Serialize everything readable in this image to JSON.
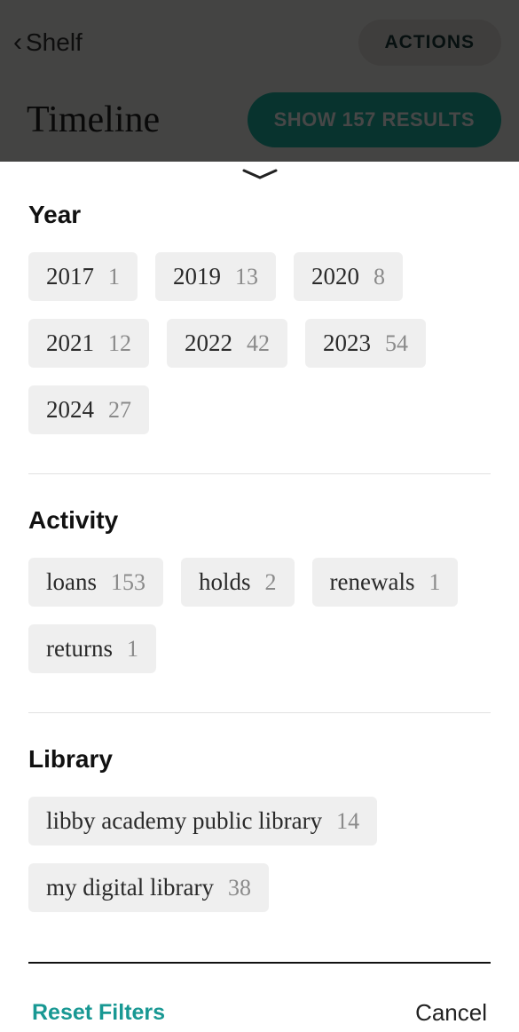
{
  "header": {
    "back_label": "Shelf",
    "actions_label": "ACTIONS",
    "title": "Timeline",
    "show_results_label": "SHOW 157 RESULTS"
  },
  "sections": {
    "year": {
      "title": "Year",
      "items": [
        {
          "label": "2017",
          "count": "1"
        },
        {
          "label": "2019",
          "count": "13"
        },
        {
          "label": "2020",
          "count": "8"
        },
        {
          "label": "2021",
          "count": "12"
        },
        {
          "label": "2022",
          "count": "42"
        },
        {
          "label": "2023",
          "count": "54"
        },
        {
          "label": "2024",
          "count": "27"
        }
      ]
    },
    "activity": {
      "title": "Activity",
      "items": [
        {
          "label": "loans",
          "count": "153"
        },
        {
          "label": "holds",
          "count": "2"
        },
        {
          "label": "renewals",
          "count": "1"
        },
        {
          "label": "returns",
          "count": "1"
        }
      ]
    },
    "library": {
      "title": "Library",
      "items": [
        {
          "label": "libby academy public library",
          "count": "14"
        },
        {
          "label": "my digital library",
          "count": "38"
        }
      ]
    }
  },
  "footer": {
    "reset_label": "Reset Filters",
    "cancel_label": "Cancel"
  }
}
